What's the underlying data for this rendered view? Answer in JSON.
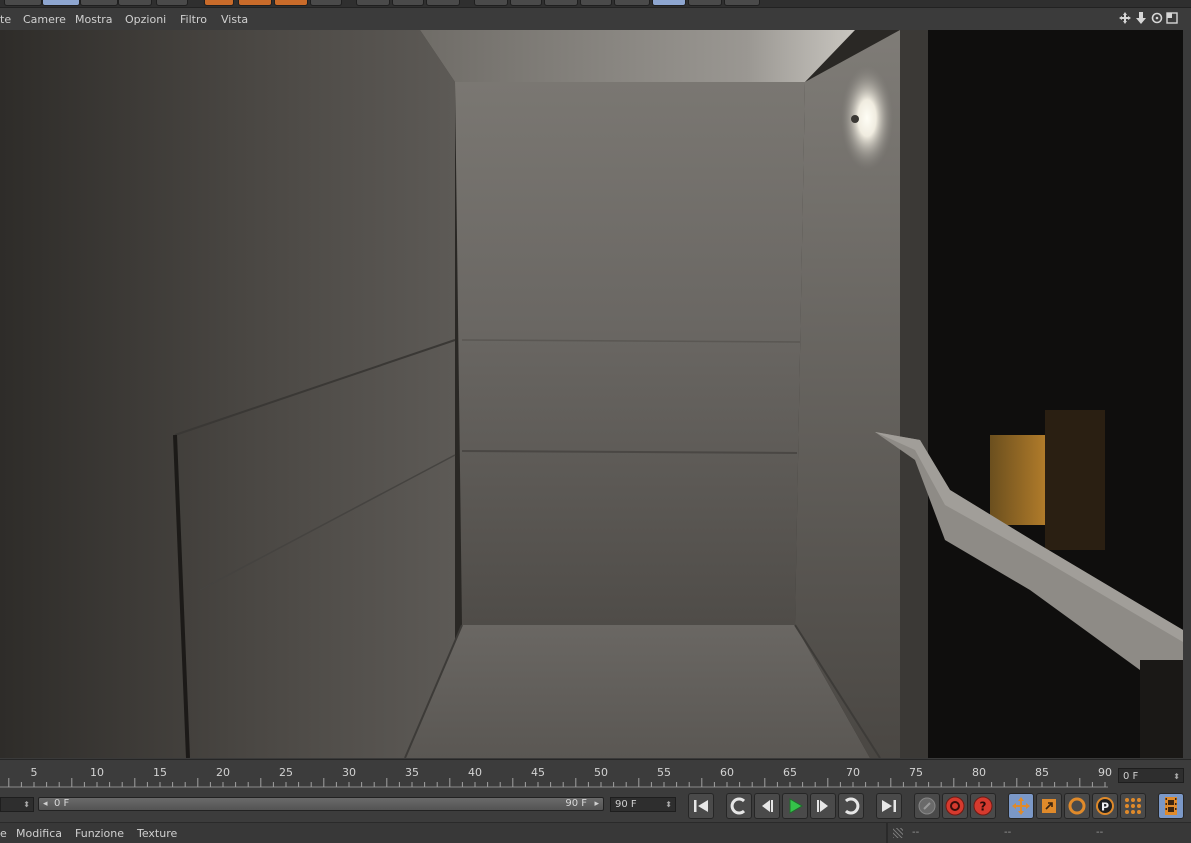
{
  "viewport_menu": {
    "items": [
      "te",
      "Camere",
      "Mostra",
      "Opzioni",
      "Filtro",
      "Vista"
    ]
  },
  "timeline": {
    "ticks": [
      "5",
      "10",
      "15",
      "20",
      "25",
      "30",
      "35",
      "40",
      "45",
      "50",
      "55",
      "60",
      "65",
      "70",
      "75",
      "80",
      "85",
      "90"
    ],
    "current_frame": "0 F",
    "range_start": "0 F",
    "range_end": "90 F",
    "end_frame": "90 F"
  },
  "bottom_menu": {
    "items": [
      "e",
      "Modifica",
      "Funzione",
      "Texture"
    ]
  },
  "status": {
    "values": [
      "--",
      "--",
      "--"
    ]
  },
  "colors": {
    "accent_select": "#7b98c7",
    "play_green": "#35c24a",
    "record_red": "#d63a2e",
    "tool_orange": "#e08a2a"
  }
}
